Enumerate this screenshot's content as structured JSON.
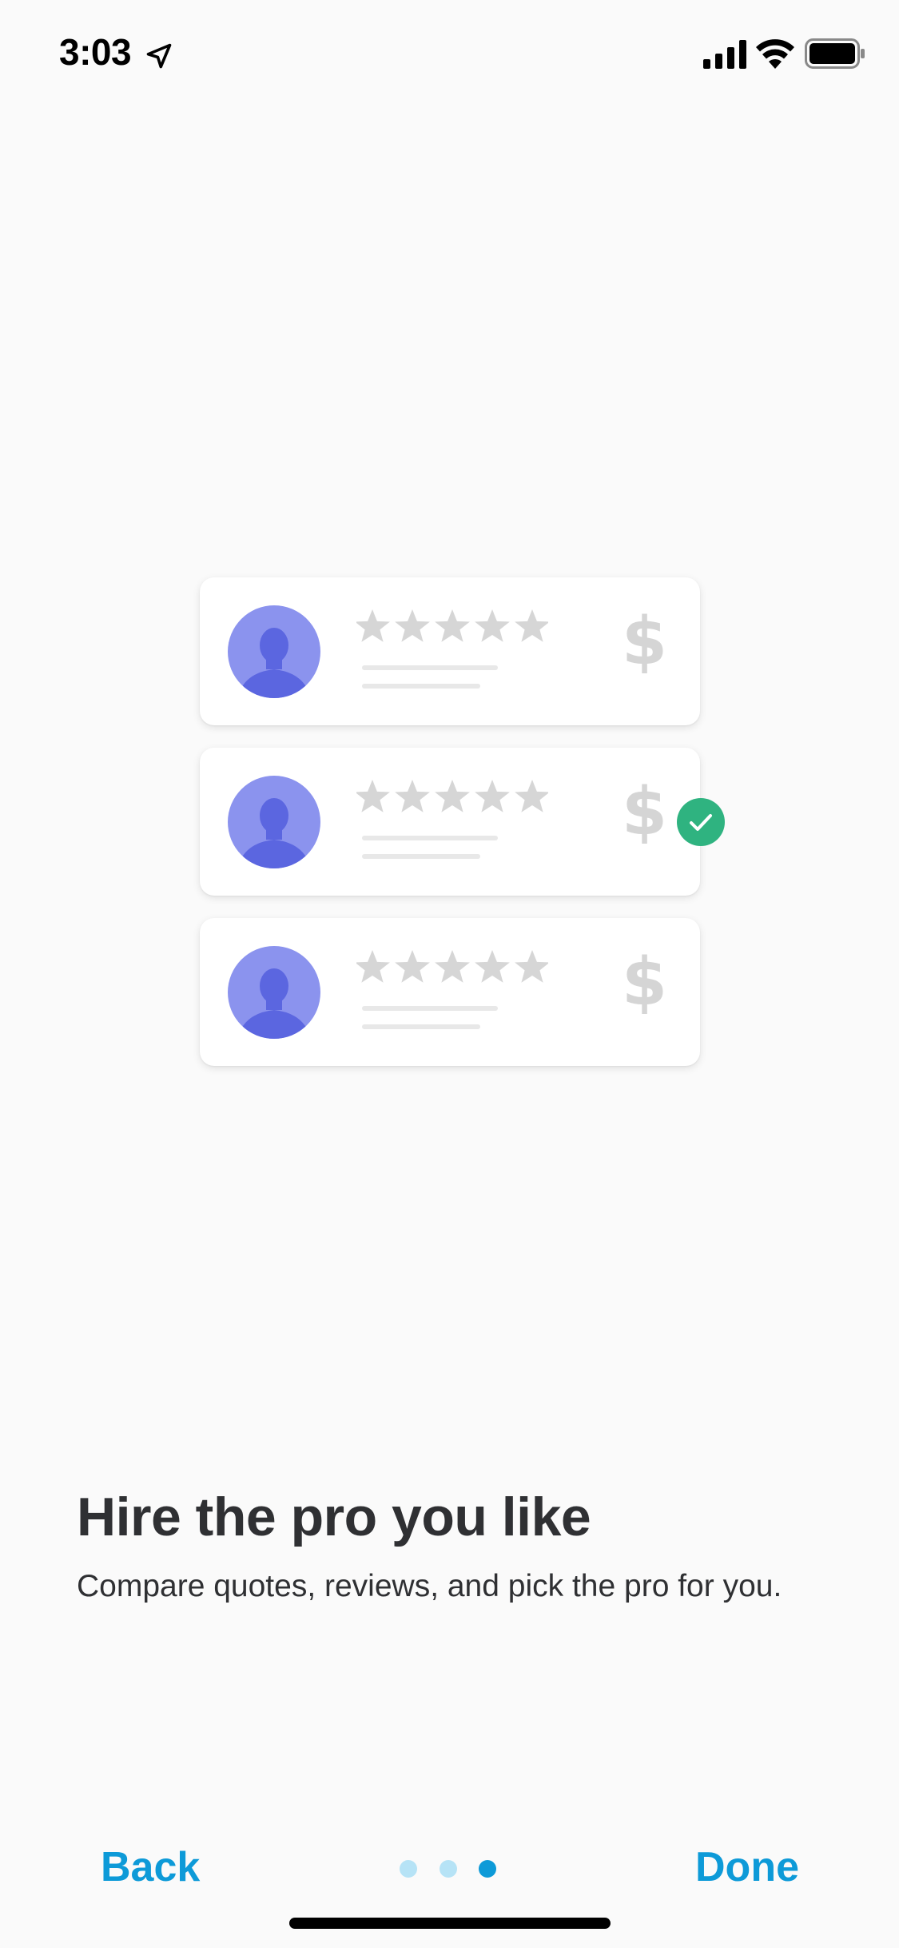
{
  "status_bar": {
    "time": "3:03",
    "icons": [
      "location-arrow-icon",
      "cellular-signal-icon",
      "wifi-icon",
      "battery-icon"
    ]
  },
  "illustration": {
    "cards": [
      {
        "price_symbol": "$",
        "rating_stars": 5,
        "selected": false
      },
      {
        "price_symbol": "$",
        "rating_stars": 5,
        "selected": true
      },
      {
        "price_symbol": "$",
        "rating_stars": 5,
        "selected": false
      }
    ],
    "colors": {
      "avatar_bg": "#8b93ee",
      "avatar_figure": "#5b66e0",
      "stars": "#d6d6d6",
      "check": "#2fb380"
    },
    "icons": [
      "person-avatar-icon",
      "star-icon",
      "dollar-icon",
      "checkmark-icon"
    ]
  },
  "content": {
    "headline": "Hire the pro you like",
    "subtext": "Compare quotes, reviews, and pick the pro for you."
  },
  "navigation": {
    "back_label": "Back",
    "done_label": "Done",
    "page_count": 3,
    "current_page": 3,
    "colors": {
      "accent": "#0d9ad8",
      "dot_inactive": "#b6e3f6",
      "dot_active": "#0d9ad8"
    }
  }
}
